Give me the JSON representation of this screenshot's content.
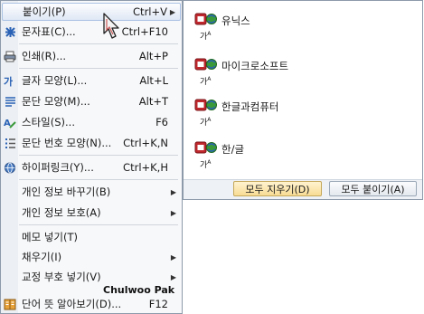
{
  "menu": {
    "items": [
      {
        "label": "붙이기(P)",
        "shortcut": "Ctrl+V",
        "submenu": true,
        "icon": "paste-icon"
      },
      {
        "label": "문자표(C)...",
        "shortcut": "Ctrl+F10",
        "icon": "character-map-icon"
      },
      {
        "label": "인쇄(R)...",
        "shortcut": "Alt+P",
        "icon": "printer-icon"
      },
      {
        "label": "글자 모양(L)...",
        "shortcut": "Alt+L",
        "icon": "font-shape-icon"
      },
      {
        "label": "문단 모양(M)...",
        "shortcut": "Alt+T",
        "icon": "paragraph-shape-icon"
      },
      {
        "label": "스타일(S)...",
        "shortcut": "F6",
        "icon": "style-icon"
      },
      {
        "label": "문단 번호 모양(N)...",
        "shortcut": "Ctrl+K,N",
        "icon": "numbering-icon"
      },
      {
        "label": "하이퍼링크(Y)...",
        "shortcut": "Ctrl+K,H",
        "icon": "hyperlink-icon"
      },
      {
        "label": "개인 정보 바꾸기(B)",
        "submenu": true
      },
      {
        "label": "개인 정보 보호(A)",
        "submenu": true
      },
      {
        "label": "메모 넣기(T)"
      },
      {
        "label": "채우기(I)",
        "submenu": true
      },
      {
        "label": "교정 부호 넣기(V)",
        "submenu": true
      },
      {
        "label": "단어 뜻 알아보기(D)...",
        "shortcut": "F12",
        "icon": "dictionary-icon"
      }
    ]
  },
  "clipboard": {
    "items": [
      {
        "label": "유닉스",
        "format": "가A"
      },
      {
        "label": "마이크로소프트",
        "format": "가A"
      },
      {
        "label": "한글과컴퓨터",
        "format": "가A"
      },
      {
        "label": "한/글",
        "format": "가A"
      }
    ],
    "buttons": {
      "clear_all": "모두 지우기(D)",
      "paste_all": "모두 붙이기(A)"
    }
  },
  "watermark": "Chulwoo Pak",
  "colors": {
    "highlight_border": "#aac2e3",
    "menu_border": "#8d9aaa",
    "icon_red": "#c0282d",
    "icon_blue": "#2a62b5"
  }
}
